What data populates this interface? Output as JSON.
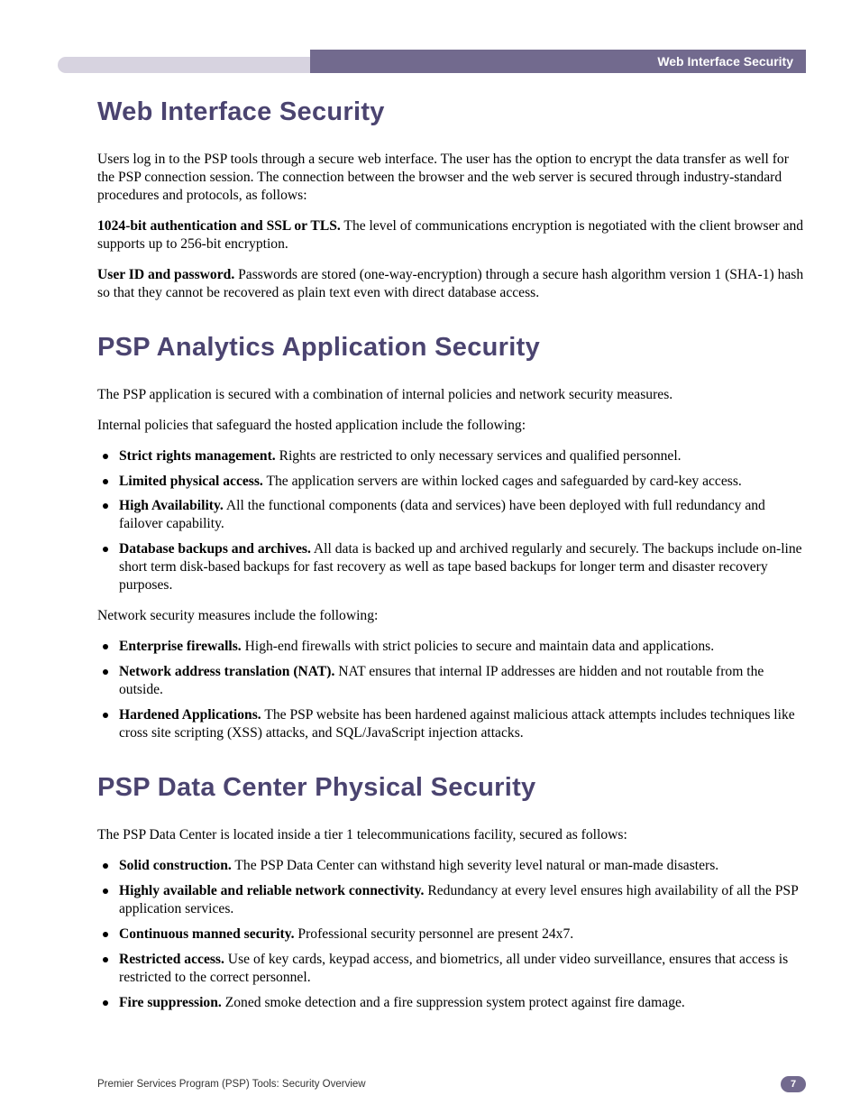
{
  "header": {
    "title": "Web Interface Security"
  },
  "sections": {
    "s1": {
      "heading": "Web Interface Security",
      "p1": "Users log in to the PSP tools through a secure web interface. The user has the option to encrypt the data transfer as well for the PSP connection session. The connection between the browser and the web server is secured through industry-standard procedures and protocols, as follows:",
      "p2_bold": "1024-bit authentication and SSL or TLS.",
      "p2_rest": " The level of communications encryption is negotiated with the client browser and supports up to 256-bit encryption.",
      "p3_bold": "User ID and password.",
      "p3_rest": " Passwords are stored (one-way-encryption) through a secure hash algorithm version 1 (SHA-1) hash so that they cannot be recovered as plain text even with direct database access."
    },
    "s2": {
      "heading": "PSP Analytics Application Security",
      "p1": "The PSP application is secured with a combination of internal policies and network security measures.",
      "p2": "Internal policies that safeguard the hosted application include the following:",
      "list1": [
        {
          "bold": "Strict rights management.",
          "rest": " Rights are restricted to only necessary services and qualified personnel."
        },
        {
          "bold": "Limited physical access.",
          "rest": " The application servers are within locked cages and safeguarded by card-key access."
        },
        {
          "bold": "High Availability.",
          "rest": " All the functional components (data and services) have been deployed with full redundancy and failover capability."
        },
        {
          "bold": "Database backups and archives.",
          "rest": " All data is backed up and archived regularly and securely. The backups include on-line short term disk-based backups for fast recovery as well as tape based backups for longer term and disaster recovery purposes."
        }
      ],
      "p3": "Network security measures include the following:",
      "list2": [
        {
          "bold": "Enterprise firewalls.",
          "rest": " High-end firewalls with strict policies to secure and maintain data and applications."
        },
        {
          "bold": "Network address translation (NAT).",
          "rest": " NAT ensures that internal IP addresses are hidden and not routable from the outside."
        },
        {
          "bold": "Hardened Applications.",
          "rest": " The PSP website has been hardened against malicious attack attempts includes techniques like cross site scripting (XSS) attacks, and SQL/JavaScript injection attacks."
        }
      ]
    },
    "s3": {
      "heading": "PSP Data Center Physical Security",
      "p1": "The PSP Data Center is located inside a tier 1 telecommunications facility, secured as follows:",
      "list1": [
        {
          "bold": "Solid construction.",
          "rest": " The PSP Data Center can withstand high severity level natural or man-made disasters."
        },
        {
          "bold": "Highly available and reliable network connectivity.",
          "rest": " Redundancy at every level ensures high availability of all the PSP application services."
        },
        {
          "bold": "Continuous manned security.",
          "rest": " Professional security personnel are present 24x7."
        },
        {
          "bold": "Restricted access.",
          "rest": " Use of key cards, keypad access, and biometrics, all under video surveillance, ensures that access is restricted to the correct personnel."
        },
        {
          "bold": "Fire suppression.",
          "rest": " Zoned smoke detection and a fire suppression system protect against fire damage."
        }
      ]
    }
  },
  "footer": {
    "text": "Premier Services Program (PSP) Tools: Security Overview",
    "page": "7"
  }
}
